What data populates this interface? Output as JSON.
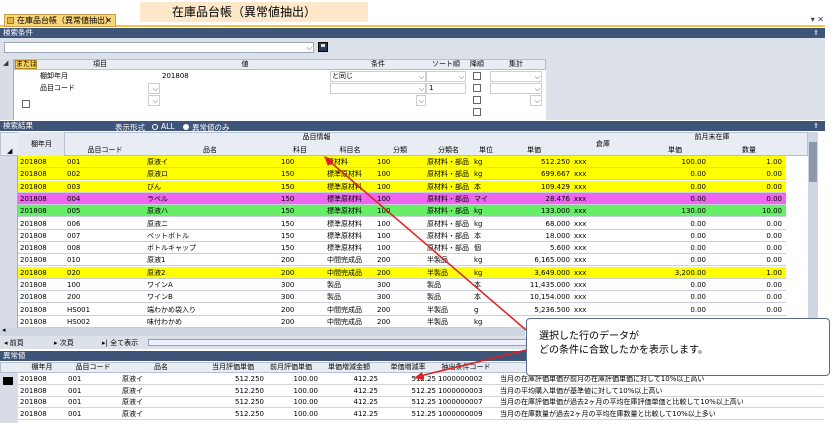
{
  "window": {
    "banner_title": "在庫品台帳（異常値抽出）",
    "tab_title": "在庫品台帳（異常値抽出）",
    "tab_close": "✕",
    "win_controls": "▾ ✕"
  },
  "search": {
    "header": "検索条件",
    "pin": "⇑",
    "columns": [
      "または",
      "項目",
      "値",
      "条件",
      "ソート順",
      "降順",
      "集計"
    ],
    "rows": [
      {
        "item": "棚卸年月",
        "value": "201808",
        "cond": "と同じ",
        "sort": "",
        "desc": false
      },
      {
        "item": "品目コード",
        "value": "",
        "cond": "",
        "sort": "1",
        "desc": false
      },
      {
        "item": "",
        "value": "",
        "cond": "",
        "sort": "",
        "desc": false
      }
    ]
  },
  "results": {
    "header": "検索結果",
    "display_label": "表示形式",
    "opt_all": "ALL",
    "opt_abnormal": "異常値のみ",
    "group_item": "品目情報",
    "group_warehouse": "倉庫",
    "group_prev": "前月末在庫",
    "col_month": "棚年月",
    "cols": [
      "品目コード",
      "品名",
      "科目",
      "科目名",
      "分類",
      "分類名",
      "単位",
      "単価",
      "",
      "単価",
      "数量"
    ],
    "rows": [
      {
        "m": "201808",
        "code": "001",
        "name": "原液イ",
        "k": "100",
        "kn": "原材料",
        "b": "100",
        "bn": "原材料・部品",
        "u": "kg",
        "p": "512.250",
        "w": "xxx",
        "pp": "100.00",
        "pq": "1.00",
        "color": "#ffff00"
      },
      {
        "m": "201808",
        "code": "002",
        "name": "原液ロ",
        "k": "150",
        "kn": "標準原材料",
        "b": "100",
        "bn": "原材料・部品",
        "u": "kg",
        "p": "699.667",
        "w": "xxx",
        "pp": "0.00",
        "pq": "0.00",
        "color": "#ffff00"
      },
      {
        "m": "201808",
        "code": "003",
        "name": "びん",
        "k": "150",
        "kn": "標準原材料",
        "b": "100",
        "bn": "原材料・部品",
        "u": "本",
        "p": "109.429",
        "w": "xxx",
        "pp": "0.00",
        "pq": "0.00",
        "color": "#ffff00"
      },
      {
        "m": "201808",
        "code": "004",
        "name": "ラベル",
        "k": "150",
        "kn": "標準原材料",
        "b": "100",
        "bn": "原材料・部品",
        "u": "マイ",
        "p": "28.476",
        "w": "xxx",
        "pp": "0.00",
        "pq": "0.00",
        "color": "#ee66ee"
      },
      {
        "m": "201808",
        "code": "005",
        "name": "原液ハ",
        "k": "150",
        "kn": "標準原材料",
        "b": "100",
        "bn": "原材料・部品",
        "u": "kg",
        "p": "133.000",
        "w": "xxx",
        "pp": "130.00",
        "pq": "10.00",
        "color": "#66ee66"
      },
      {
        "m": "201808",
        "code": "006",
        "name": "原液ニ",
        "k": "150",
        "kn": "標準原材料",
        "b": "100",
        "bn": "原材料・部品",
        "u": "kg",
        "p": "68.000",
        "w": "xxx",
        "pp": "0.00",
        "pq": "0.00",
        "color": "#ffffff"
      },
      {
        "m": "201808",
        "code": "007",
        "name": "ペットボトル",
        "k": "150",
        "kn": "標準原材料",
        "b": "100",
        "bn": "原材料・部品",
        "u": "本",
        "p": "18.000",
        "w": "xxx",
        "pp": "0.00",
        "pq": "0.00",
        "color": "#ffffff"
      },
      {
        "m": "201808",
        "code": "008",
        "name": "ボトルキャップ",
        "k": "150",
        "kn": "標準原材料",
        "b": "100",
        "bn": "原材料・部品",
        "u": "個",
        "p": "5.600",
        "w": "xxx",
        "pp": "0.00",
        "pq": "0.00",
        "color": "#ffffff"
      },
      {
        "m": "201808",
        "code": "010",
        "name": "原液1",
        "k": "200",
        "kn": "中間完成品",
        "b": "200",
        "bn": "半製品",
        "u": "kg",
        "p": "6,165.000",
        "w": "xxx",
        "pp": "0.00",
        "pq": "0.00",
        "color": "#ffffff"
      },
      {
        "m": "201808",
        "code": "020",
        "name": "原液2",
        "k": "200",
        "kn": "中間完成品",
        "b": "200",
        "bn": "半製品",
        "u": "kg",
        "p": "3,649.000",
        "w": "xxx",
        "pp": "3,200.00",
        "pq": "1.00",
        "color": "#ffff00"
      },
      {
        "m": "201808",
        "code": "100",
        "name": "ワインA",
        "k": "300",
        "kn": "製品",
        "b": "300",
        "bn": "製品",
        "u": "本",
        "p": "11,435.000",
        "w": "xxx",
        "pp": "0.00",
        "pq": "0.00",
        "color": "#ffffff"
      },
      {
        "m": "201808",
        "code": "200",
        "name": "ワインB",
        "k": "300",
        "kn": "製品",
        "b": "300",
        "bn": "製品",
        "u": "本",
        "p": "10,154.000",
        "w": "xxx",
        "pp": "0.00",
        "pq": "0.00",
        "color": "#ffffff"
      },
      {
        "m": "201808",
        "code": "HS001",
        "name": "端わかめ袋入り",
        "k": "200",
        "kn": "中間完成品",
        "b": "200",
        "bn": "半製品",
        "u": "g",
        "p": "5,236.500",
        "w": "xxx",
        "pp": "0.00",
        "pq": "0.00",
        "color": "#ffffff"
      },
      {
        "m": "201808",
        "code": "HS002",
        "name": "味付わかめ",
        "k": "200",
        "kn": "中間完成品",
        "b": "200",
        "bn": "半製品",
        "u": "kg",
        "p": "",
        "w": "",
        "pp": "",
        "pq": "",
        "color": "#ffffff"
      }
    ],
    "nav_prev": "前頁",
    "nav_next": "次頁",
    "nav_all": "全て表示"
  },
  "callout": {
    "line1": "選択した行のデータが",
    "line2": "どの条件に合致したかを表示します。"
  },
  "abnormal": {
    "header": "異常値",
    "cols": [
      "棚年月",
      "品目コード",
      "品名",
      "当月評価単価",
      "前月評価単価",
      "単価増減金額",
      "単価増減率",
      "抽出条件コード",
      ""
    ],
    "rows": [
      {
        "m": "201808",
        "code": "001",
        "name": "原液イ",
        "cur": "512.250",
        "prev": "100.00",
        "diff": "412.25",
        "rate": "512.25",
        "cc": "1000000002",
        "desc": "当月の在庫評価単価が前月の在庫評価単価に対して10%以上高い"
      },
      {
        "m": "201808",
        "code": "001",
        "name": "原液イ",
        "cur": "512.250",
        "prev": "100.00",
        "diff": "412.25",
        "rate": "512.25",
        "cc": "1000000003",
        "desc": "当月の平均購入単価が基準値に対して10%以上高い"
      },
      {
        "m": "201808",
        "code": "001",
        "name": "原液イ",
        "cur": "512.250",
        "prev": "100.00",
        "diff": "412.25",
        "rate": "512.25",
        "cc": "1000000007",
        "desc": "当月の在庫評価単価が過去2ヶ月の平均在庫評価単価と比較して10%以上高い"
      },
      {
        "m": "201808",
        "code": "001",
        "name": "原液イ",
        "cur": "512.250",
        "prev": "100.00",
        "diff": "412.25",
        "rate": "512.25",
        "cc": "1000000009",
        "desc": "当月の在庫数量が過去2ヶ月の平均在庫数量と比較して10%以上多い"
      }
    ]
  },
  "colors": {
    "header_bar": "#3f5479",
    "highlight_yellow": "#ffff00",
    "highlight_pink": "#ee66ee",
    "highlight_green": "#66ee66",
    "arrow": "#e02020"
  }
}
